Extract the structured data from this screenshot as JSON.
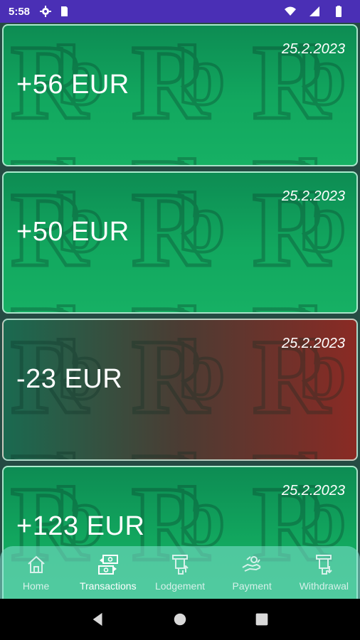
{
  "status_bar": {
    "time": "5:58",
    "icons": [
      "gear-icon",
      "sim-card-icon",
      "wifi-icon",
      "signal-icon",
      "battery-icon"
    ]
  },
  "transactions": [
    {
      "amount": "+56 EUR",
      "date": "25.2.2023",
      "type": "positive"
    },
    {
      "amount": "+50 EUR",
      "date": "25.2.2023",
      "type": "positive"
    },
    {
      "amount": "-23 EUR",
      "date": "25.2.2023",
      "type": "negative"
    },
    {
      "amount": "+123 EUR",
      "date": "25.2.2023",
      "type": "positive"
    }
  ],
  "bottom_nav": {
    "items": [
      {
        "label": "Home",
        "icon": "home-icon",
        "active": false
      },
      {
        "label": "Transactions",
        "icon": "transactions-icon",
        "active": true
      },
      {
        "label": "Lodgement",
        "icon": "lodgement-icon",
        "active": false
      },
      {
        "label": "Payment",
        "icon": "payment-icon",
        "active": false
      },
      {
        "label": "Withdrawal",
        "icon": "withdrawal-icon",
        "active": false
      }
    ]
  },
  "colors": {
    "status_bar": "#4a2fb5",
    "positive": "#12a85f",
    "negative": "#8a2a24",
    "nav_bg": "#82e1d2"
  }
}
